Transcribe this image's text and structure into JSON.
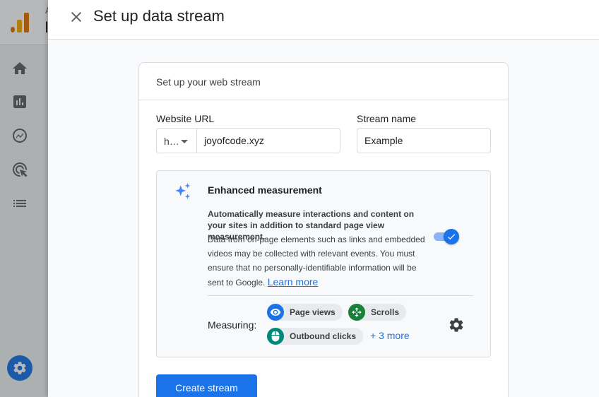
{
  "app": {
    "crumb_small": "A",
    "crumb_large": "I",
    "rail_icons": [
      "home-icon",
      "reports-icon",
      "explore-icon",
      "advertising-icon",
      "configure-icon"
    ],
    "admin_icon": "gear-icon",
    "accent_color": "#1a73e8"
  },
  "panel": {
    "title": "Set up data stream",
    "close_icon": "close-icon"
  },
  "card": {
    "header": "Set up your web stream",
    "website_url_label": "Website URL",
    "protocol_value": "h…",
    "url_value": "joyofcode.xyz",
    "stream_name_label": "Stream name",
    "stream_name_value": "Example"
  },
  "enhanced": {
    "title": "Enhanced measurement",
    "bold_text": "Automatically measure interactions and content on your sites in addition to standard page view measurement.",
    "desc_text": "Data from on-page elements such as links and embedded videos may be collected with relevant events. You must ensure that no personally-identifiable information will be sent to Google.",
    "learn_more": "Learn more",
    "toggle_on": true,
    "measuring_label": "Measuring:",
    "chips": [
      {
        "label": "Page views",
        "icon": "eye-icon",
        "color": "#1a73e8"
      },
      {
        "label": "Scrolls",
        "icon": "move-icon",
        "color": "#188038"
      },
      {
        "label": "Outbound clicks",
        "icon": "mouse-icon",
        "color": "#00897b"
      }
    ],
    "more_label": "+ 3 more"
  },
  "actions": {
    "create_label": "Create stream"
  }
}
